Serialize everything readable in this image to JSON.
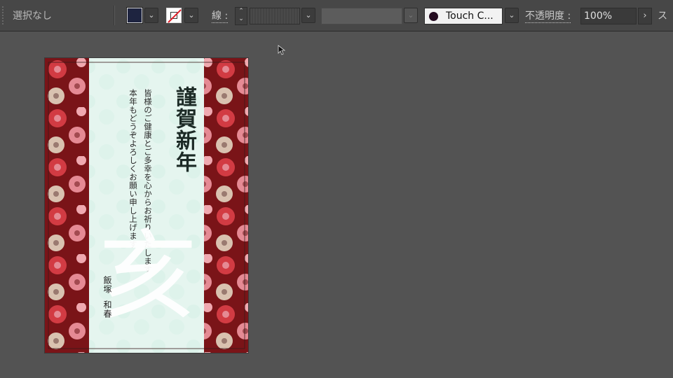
{
  "toolbar": {
    "selection_label": "選択なし",
    "stroke_label": "線 :",
    "style_name": "Touch C...",
    "opacity_label": "不透明度 :",
    "opacity_value": "100%",
    "next_label": "ス",
    "fill_color": "#1e2440",
    "style_color": "#240b20"
  },
  "card": {
    "greeting": "謹賀新年",
    "message_line1": "皆様のご健康とご多幸を心からお祈りいたします",
    "message_line2": "本年もどうぞよろしくお願い申し上げます",
    "zodiac_kanji": "亥",
    "sender_last": "飯塚",
    "sender_first": "和春",
    "colors": {
      "border_red": "#7a1418",
      "center_mint": "#e3f3ee",
      "flower_pink": "#e58a94",
      "flower_red": "#d23b43",
      "flower_beige": "#d9c2b0"
    }
  }
}
